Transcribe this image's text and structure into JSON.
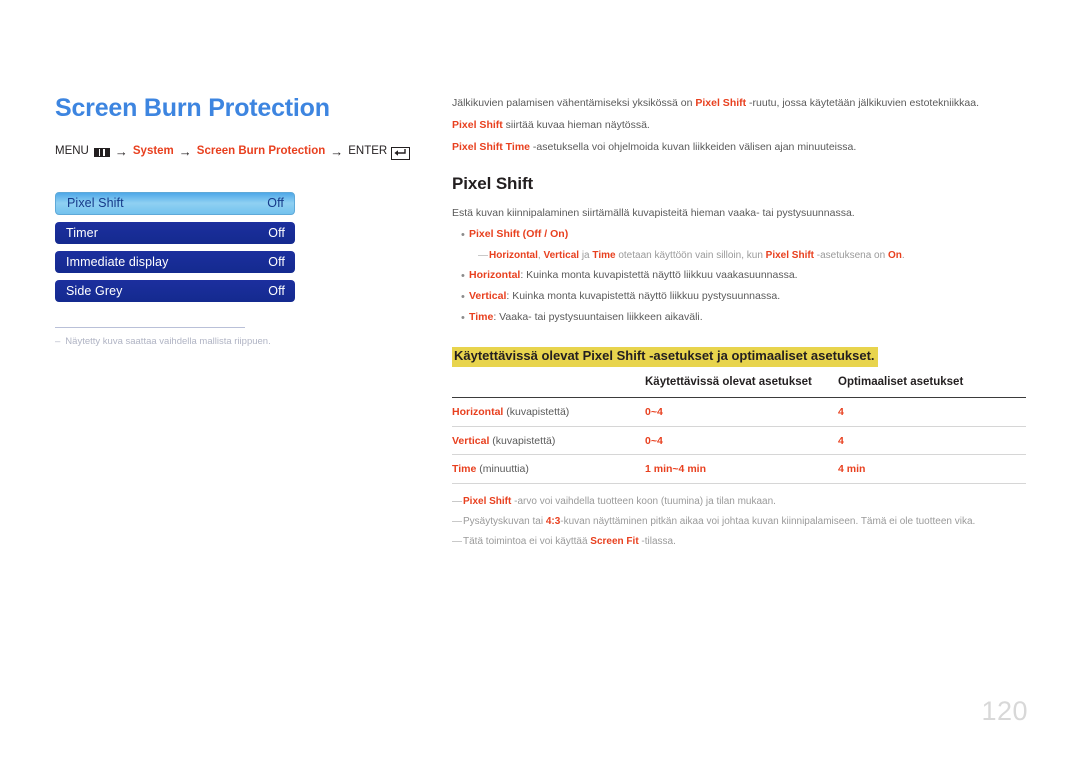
{
  "document": {
    "title": "Screen Burn Protection",
    "page_number": "120"
  },
  "breadcrumb": {
    "menu_label": "MENU",
    "menu_icon": "menu-bars-icon",
    "arrow": "→",
    "step_system": "System",
    "step_screen_burn": "Screen Burn Protection",
    "enter_label": "ENTER",
    "enter_icon": "enter-key-icon"
  },
  "osd": {
    "rows": [
      {
        "label": "Pixel Shift",
        "value": "Off",
        "selected": true
      },
      {
        "label": "Timer",
        "value": "Off",
        "selected": false
      },
      {
        "label": "Immediate display",
        "value": "Off",
        "selected": false
      },
      {
        "label": "Side Grey",
        "value": "Off",
        "selected": false
      }
    ]
  },
  "left_note": {
    "dash": "–",
    "text": "Näytetty kuva saattaa vaihdella mallista riippuen."
  },
  "intro": {
    "p1_a": "Jälkikuvien palamisen vähentämiseksi yksikössä on ",
    "p1_b": "Pixel Shift",
    "p1_c": " -ruutu, jossa käytetään jälkikuvien estotekniikkaa.",
    "p2_a": "Pixel Shift",
    "p2_b": " siirtää kuvaa hieman näytössä.",
    "p3_a": "Pixel Shift Time",
    "p3_b": " -asetuksella voi ohjelmoida kuvan liikkeiden välisen ajan minuuteissa."
  },
  "section": {
    "title": "Pixel Shift",
    "lead": "Estä kuvan kiinnipalaminen siirtämällä kuvapisteitä hieman vaaka- tai pystysuunnassa."
  },
  "bullets": {
    "b1": {
      "dot": "•",
      "term": "Pixel Shift",
      "rest_plain": " (",
      "opt1": "Off",
      "sep": " / ",
      "opt2": "On",
      "close": ")"
    },
    "subnote1": {
      "dash": "―",
      "t1": "Horizontal",
      "t1b": ", ",
      "t2": "Vertical",
      "t2b": " ja ",
      "t3": "Time",
      "mid": " otetaan käyttöön vain silloin, kun ",
      "t4": "Pixel Shift",
      "mid2": " -asetuksena on ",
      "t5": "On",
      "end": "."
    },
    "b2": {
      "dot": "•",
      "term": "Horizontal",
      "text": ": Kuinka monta kuvapistettä näyttö liikkuu vaakasuunnassa."
    },
    "b3": {
      "dot": "•",
      "term": "Vertical",
      "text": ": Kuinka monta kuvapistettä näyttö liikkuu pystysuunnassa."
    },
    "b4": {
      "dot": "•",
      "term": "Time",
      "text": ": Vaaka- tai pystysuuntaisen liikkeen aikaväli."
    }
  },
  "highlight_heading": "Käytettävissä olevat Pixel Shift -asetukset ja optimaaliset asetukset.",
  "table": {
    "headers": [
      "",
      "Käytettävissä olevat asetukset",
      "Optimaaliset asetukset"
    ],
    "rows": [
      {
        "term": "Horizontal",
        "unit": " (kuvapistettä)",
        "available": "0~4",
        "optimal": "4"
      },
      {
        "term": "Vertical",
        "unit": " (kuvapistettä)",
        "available": "0~4",
        "optimal": "4"
      },
      {
        "term": "Time",
        "unit": " (minuuttia)",
        "available": "1 min~4 min",
        "optimal": "4 min"
      }
    ]
  },
  "foot_notes": {
    "n1": {
      "dash": "―",
      "term": "Pixel Shift",
      "text": " -arvo voi vaihdella tuotteen koon (tuumina) ja tilan mukaan."
    },
    "n2": {
      "dash": "―",
      "pre": "Pysäytyskuvan tai ",
      "term": "4:3",
      "text": "-kuvan näyttäminen pitkän aikaa voi johtaa kuvan kiinnipalamiseen. Tämä ei ole tuotteen vika."
    },
    "n3": {
      "dash": "―",
      "pre": "Tätä toimintoa ei voi käyttää ",
      "term": "Screen Fit",
      "text": " -tilassa."
    }
  },
  "colors": {
    "title_blue": "#3d85e0",
    "accent_red": "#e8401f",
    "highlight_yellow": "#e8d44d",
    "osd_navy": "#1c2f9e",
    "osd_selected_blue": "#8fd0f2"
  }
}
